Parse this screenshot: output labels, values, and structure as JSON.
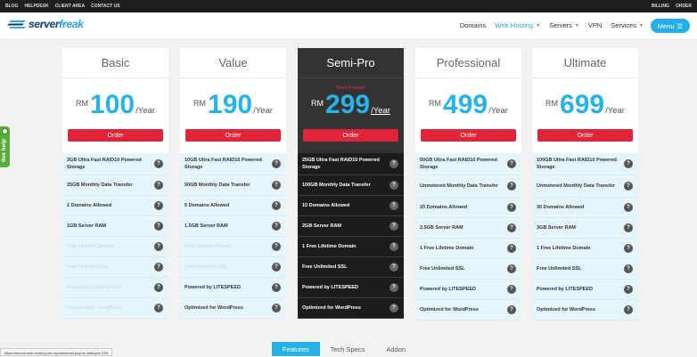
{
  "topbar": {
    "left_links": [
      "BLOG",
      "HELPDESK",
      "CLIENT AREA",
      "CONTACT US"
    ],
    "right_links": [
      "BILLING",
      "ORDER"
    ]
  },
  "brand": {
    "name_part1": "server",
    "name_part2": "freak",
    "tagline": "Premium Hosting Solutions",
    "colors": {
      "navy": "#1a3360",
      "blue": "#2aa6e0"
    }
  },
  "nav": {
    "items": [
      {
        "label": "Domains",
        "caret": false
      },
      {
        "label": "Web Hosting",
        "caret": true,
        "active": true
      },
      {
        "label": "Servers",
        "caret": true
      },
      {
        "label": "VPN",
        "caret": false
      },
      {
        "label": "Services",
        "caret": true
      }
    ],
    "menu_button": "Menu"
  },
  "live_help": "live help",
  "plans": [
    {
      "name": "Basic",
      "currency": "RM",
      "amount": "100",
      "period": "/Year",
      "order": "Order",
      "features": [
        {
          "label": "3GB Ultra Fast RAID10 Powered Storage",
          "on": true
        },
        {
          "label": "25GB Monthly Data Transfer",
          "on": true
        },
        {
          "label": "2 Domains Allowed",
          "on": true
        },
        {
          "label": "1GB Server RAM",
          "on": true
        },
        {
          "label": "Free Lifetime Domain",
          "on": false
        },
        {
          "label": "Free Unlimited SSL",
          "on": false
        },
        {
          "label": "Powered by LITESPEED",
          "on": false
        },
        {
          "label": "Optimized for WordPress",
          "on": false
        }
      ]
    },
    {
      "name": "Value",
      "currency": "RM",
      "amount": "190",
      "period": "/Year",
      "order": "Order",
      "features": [
        {
          "label": "10GB Ultra Fast RAID10 Powered Storage",
          "on": true
        },
        {
          "label": "50GB Monthly Data Transfer",
          "on": true
        },
        {
          "label": "5 Domains Allowed",
          "on": true
        },
        {
          "label": "1.5GB Server RAM",
          "on": true
        },
        {
          "label": "Free Lifetime Domain",
          "on": false
        },
        {
          "label": "Free Unlimited SSL",
          "on": false
        },
        {
          "label": "Powered by LITESPEED",
          "on": true
        },
        {
          "label": "Optimized for WordPress",
          "on": true
        }
      ]
    },
    {
      "name": "Semi-Pro",
      "badge": "Most Popular",
      "currency": "RM",
      "amount": "299",
      "period": "/Year",
      "order": "Order",
      "features": [
        {
          "label": "25GB Ultra Fast RAID10 Powered Storage",
          "on": true
        },
        {
          "label": "100GB Monthly Data Transfer",
          "on": true
        },
        {
          "label": "10 Domains Allowed",
          "on": true
        },
        {
          "label": "2GB Server RAM",
          "on": true
        },
        {
          "label": "1 Free Lifetime Domain",
          "on": true
        },
        {
          "label": "Free Unlimited SSL",
          "on": true
        },
        {
          "label": "Powered by LITESPEED",
          "on": true
        },
        {
          "label": "Optimized for WordPress",
          "on": true
        }
      ]
    },
    {
      "name": "Professional",
      "currency": "RM",
      "amount": "499",
      "period": "/Year",
      "order": "Order",
      "features": [
        {
          "label": "50GB Ultra Fast RAID10 Powered Storage",
          "on": true
        },
        {
          "label": "Unmetered Monthly Data Transfer",
          "on": true
        },
        {
          "label": "20 Domains Allowed",
          "on": true
        },
        {
          "label": "2.5GB Server RAM",
          "on": true
        },
        {
          "label": "1 Free Lifetime Domain",
          "on": true
        },
        {
          "label": "Free Unlimited SSL",
          "on": true
        },
        {
          "label": "Powered by LITESPEED",
          "on": true
        },
        {
          "label": "Optimized for WordPress",
          "on": true
        }
      ]
    },
    {
      "name": "Ultimate",
      "currency": "RM",
      "amount": "699",
      "period": "/Year",
      "order": "Order",
      "features": [
        {
          "label": "100GB Ultra Fast RAID10 Powered Storage",
          "on": true
        },
        {
          "label": "Unmetered Monthly Data Transfer",
          "on": true
        },
        {
          "label": "30 Domains Allowed",
          "on": true
        },
        {
          "label": "3GB Server RAM",
          "on": true
        },
        {
          "label": "1 Free Lifetime Domain",
          "on": true
        },
        {
          "label": "Free Unlimited SSL",
          "on": true
        },
        {
          "label": "Powered by LITESPEED",
          "on": true
        },
        {
          "label": "Optimized for WordPress",
          "on": true
        }
      ]
    }
  ],
  "status_url": "https://secure.web-hosting.net.my/client/cart.php?a=add&pid=196",
  "tabs": [
    "Features",
    "Tech Specs",
    "Addon"
  ]
}
